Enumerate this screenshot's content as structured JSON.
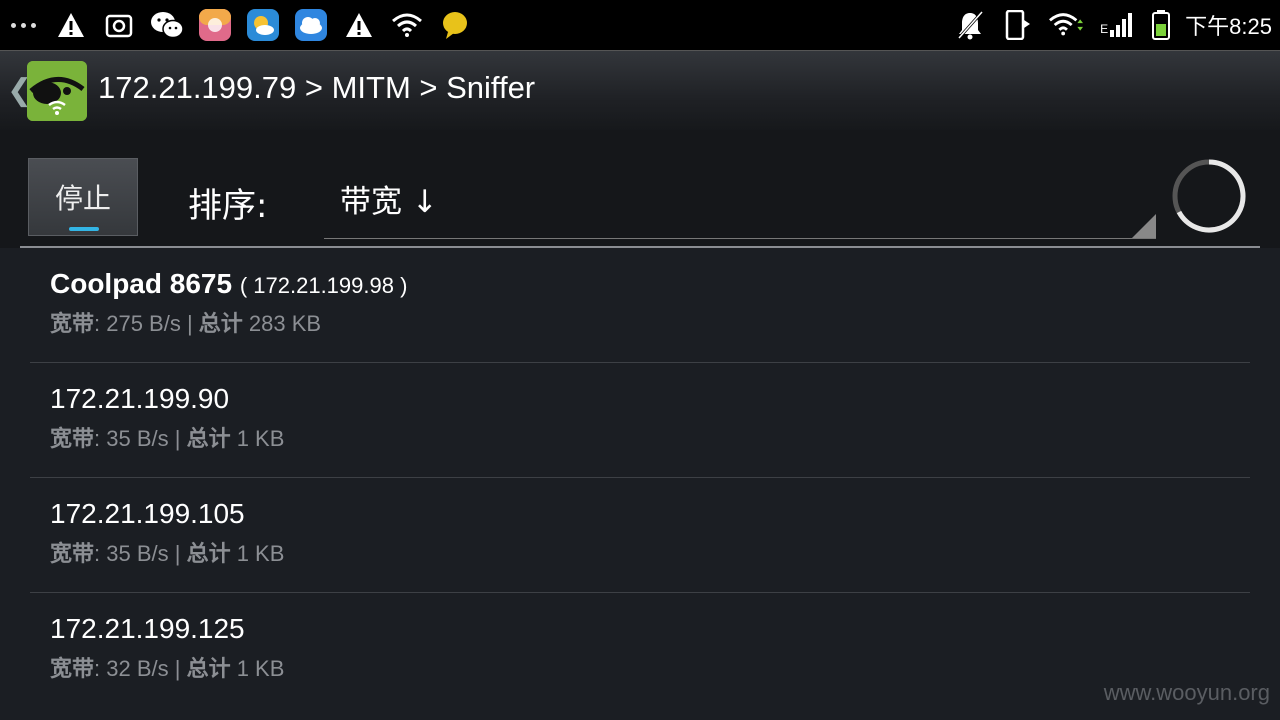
{
  "status_bar": {
    "time": "下午8:25",
    "left_icons": [
      "overflow-dots-icon",
      "warning-icon",
      "screenshot-icon",
      "wechat-icon",
      "app-icon",
      "weather-icon",
      "cloud-icon",
      "warning-icon",
      "wifi-icon",
      "chat-bubble-icon"
    ],
    "right_icons": [
      "notifications-off-icon",
      "phone-icon",
      "wifi-icon",
      "signal-icon",
      "battery-icon"
    ],
    "network_type": "E"
  },
  "action_bar": {
    "title": "172.21.199.79 > MITM > Sniffer"
  },
  "toolbar": {
    "stop_label": "停止",
    "sort_label": "排序:",
    "sort_value": "带宽 ↓"
  },
  "hosts": [
    {
      "name": "Coolpad 8675",
      "ip": "( 172.21.199.98 )",
      "bw_label": "宽带",
      "bw_value": ": 275 B/s | ",
      "total_label": "总计",
      "total_value": " 283 KB"
    },
    {
      "name": "172.21.199.90",
      "ip": "",
      "bw_label": "宽带",
      "bw_value": ": 35 B/s | ",
      "total_label": "总计",
      "total_value": " 1 KB"
    },
    {
      "name": "172.21.199.105",
      "ip": "",
      "bw_label": "宽带",
      "bw_value": ": 35 B/s | ",
      "total_label": "总计",
      "total_value": " 1 KB"
    },
    {
      "name": "172.21.199.125",
      "ip": "",
      "bw_label": "宽带",
      "bw_value": ": 32 B/s | ",
      "total_label": "总计",
      "total_value": " 1 KB"
    }
  ],
  "watermark": "www.wooyun.org",
  "colors": {
    "accent": "#33b5e5",
    "background": "#1b1e23",
    "secondary_text": "#8c8f94"
  }
}
